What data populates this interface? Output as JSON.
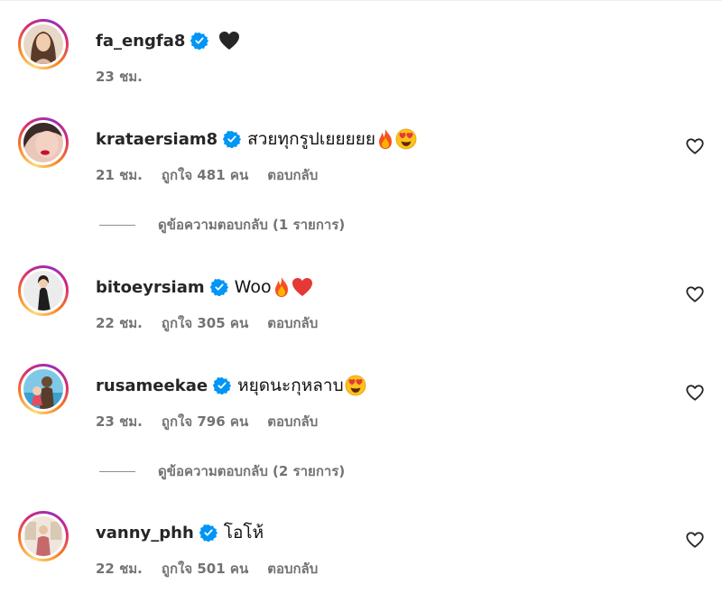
{
  "comments": [
    {
      "username": "fa_engfa8",
      "text": "",
      "emojis": [
        "black-heart"
      ],
      "time": "23 ชม.",
      "likes": "",
      "reply": "",
      "show_heart": false,
      "avatar": "portrait-woman"
    },
    {
      "username": "krataersiam8",
      "text": "สวยทุกรูปเยยยยย",
      "emojis": [
        "fire",
        "heart-eyes"
      ],
      "time": "21 ชม.",
      "likes": "ถูกใจ 481 คน",
      "reply": "ตอบกลับ",
      "show_heart": true,
      "avatar": "portrait-red-lips"
    },
    {
      "username": "bitoeyrsiam",
      "text": "Woo",
      "emojis": [
        "fire",
        "red-heart"
      ],
      "time": "22 ชม.",
      "likes": "ถูกใจ 305 คน",
      "reply": "ตอบกลับ",
      "show_heart": true,
      "avatar": "portrait-dark-dress"
    },
    {
      "username": "rusameekae",
      "text": "หยุดนะกุหลาบ",
      "emojis": [
        "heart-eyes"
      ],
      "time": "23 ชม.",
      "likes": "ถูกใจ 796 คน",
      "reply": "ตอบกลับ",
      "show_heart": true,
      "avatar": "family-pool"
    },
    {
      "username": "vanny_phh",
      "text": "โอโห้",
      "emojis": [],
      "time": "22 ชม.",
      "likes": "ถูกใจ 501 คน",
      "reply": "ตอบกลับ",
      "show_heart": true,
      "avatar": "portrait-indoor"
    }
  ],
  "view_replies": [
    {
      "label": "ดูข้อความตอบกลับ (1 รายการ)"
    },
    {
      "label": "ดูข้อความตอบกลับ (2 รายการ)"
    }
  ],
  "colors": {
    "verified": "#0095f6",
    "muted_text": "#737373",
    "ring": "#d62976"
  }
}
